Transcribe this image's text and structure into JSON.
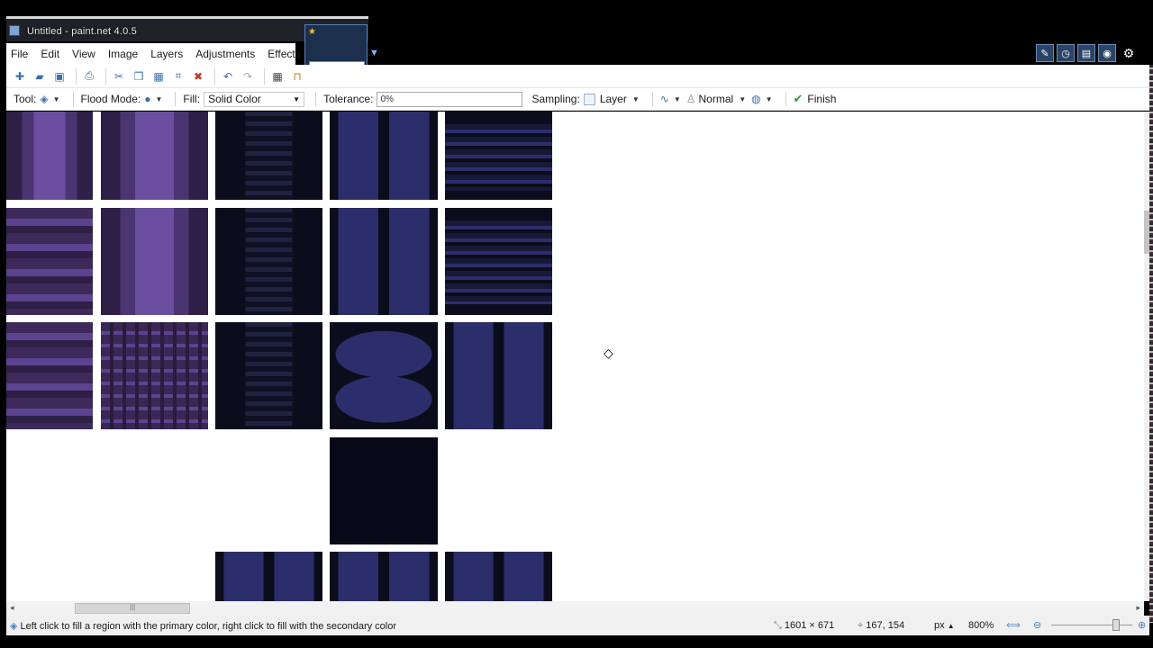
{
  "window": {
    "title": "Untitled - paint.net 4.0.5"
  },
  "menu": {
    "items": [
      "File",
      "Edit",
      "View",
      "Image",
      "Layers",
      "Adjustments",
      "Effects"
    ]
  },
  "tool_options": {
    "tool_label": "Tool:",
    "flood_mode_label": "Flood Mode:",
    "fill_label": "Fill:",
    "fill_value": "Solid Color",
    "tolerance_label": "Tolerance:",
    "tolerance_value": "0%",
    "sampling_label": "Sampling:",
    "sampling_value": "Layer",
    "blend_mode": "Normal",
    "finish_label": "Finish"
  },
  "status": {
    "hint": "Left click to fill a region with the primary color, right click to fill with the secondary color",
    "image_size": "1601 × 671",
    "cursor_position": "167, 154",
    "units": "px",
    "zoom": "800%"
  },
  "icons": {
    "toolbar": [
      "new-icon",
      "open-icon",
      "save-icon",
      "print-icon",
      "cut-icon",
      "copy-icon",
      "paste-icon",
      "crop-icon",
      "deselect-icon",
      "undo-icon",
      "redo-icon",
      "grid-icon",
      "ruler-icon"
    ],
    "util": [
      "tools-window-icon",
      "history-window-icon",
      "layers-window-icon",
      "colors-window-icon",
      "settings-gear-icon"
    ]
  },
  "colors": {
    "purple_tile": "#3a2754",
    "dark_blue_tile": "#0b0d1c",
    "blue_panel": "#2c2e6c",
    "accent": "#3a6fb0"
  }
}
